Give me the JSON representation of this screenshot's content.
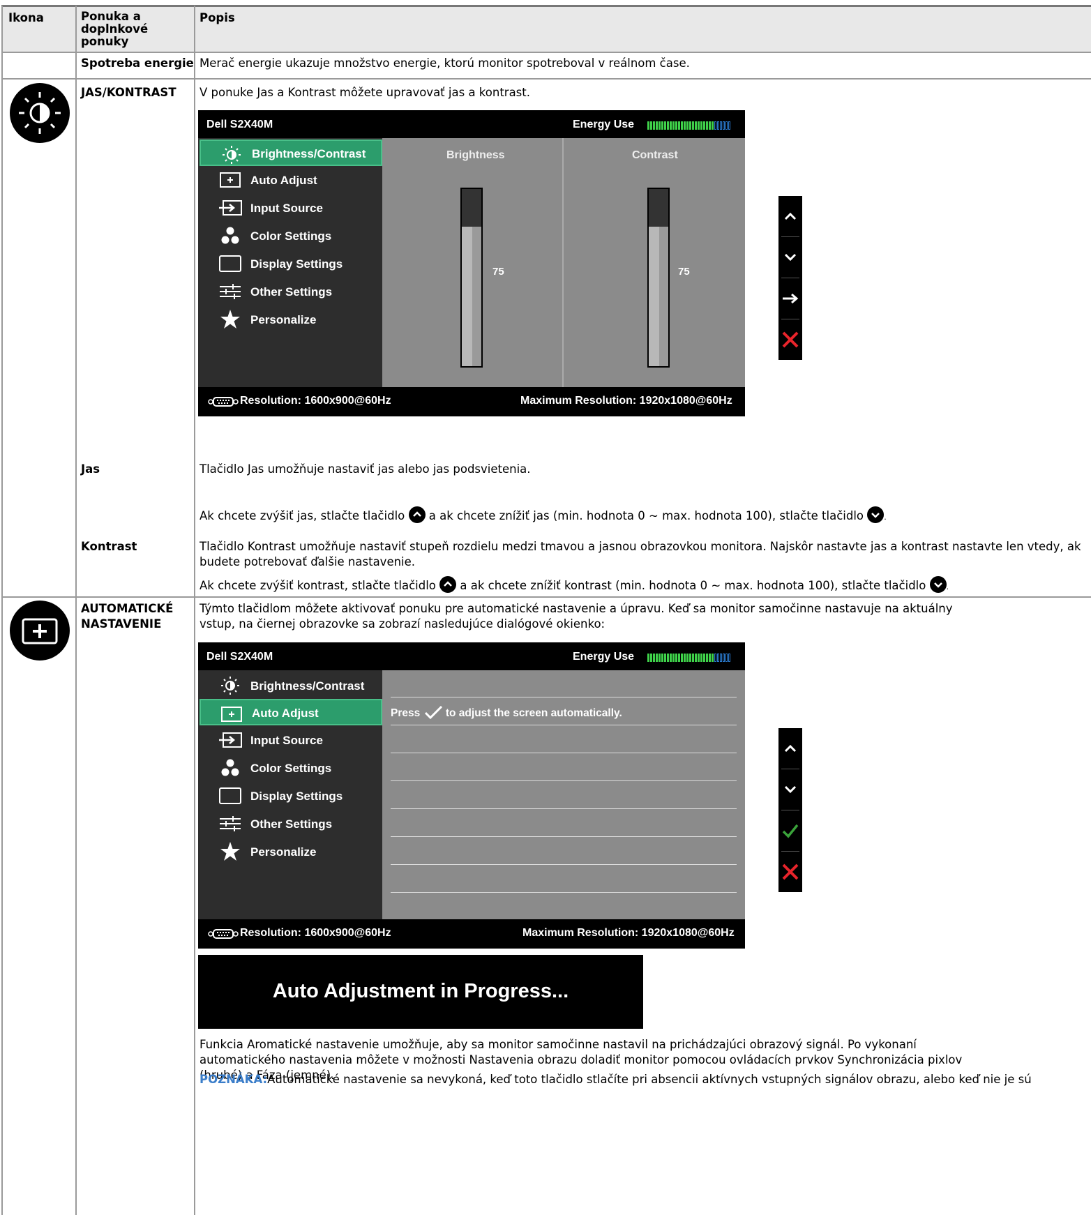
{
  "header": {
    "col_icon": "Ikona",
    "col_menu": "Ponuka a doplnkové ponuky",
    "col_menu_l1": "Ponuka a",
    "col_menu_l2": "doplnkové",
    "col_menu_l3": "ponuky",
    "col_desc": "Popis"
  },
  "rows": {
    "energy": {
      "name": "Spotreba energie",
      "desc": "Merač energie ukazuje množstvo energie, ktorú monitor spotreboval v reálnom čase."
    },
    "brightness": {
      "name": "JAS/KONTRAST",
      "desc": "V ponuke Jas a Kontrast môžete upravovať jas a kontrast."
    },
    "jas": {
      "name": "Jas",
      "desc": "Tlačidlo Jas umožňuje nastaviť jas alebo jas podsvietenia.",
      "desc2a": "Ak chcete zvýšiť jas, stlačte tlačidlo",
      "desc2b": "a ak chcete znížiť jas (min. hodnota 0 ~ max. hodnota 100), stlačte tlačidlo",
      "desc2c": "."
    },
    "kontrast": {
      "name": "Kontrast",
      "desc": "Tlačidlo Kontrast umožňuje nastaviť stupeň rozdielu medzi tmavou a jasnou obrazovkou monitora. Najskôr nastavte jas a kontrast nastavte len vtedy, ak budete potrebovať ďalšie nastavenie.",
      "desc2a": "Ak chcete zvýšiť kontrast, stlačte tlačidlo",
      "desc2b": "a ak chcete znížiť kontrast (min. hodnota 0 ~ max. hodnota 100), stlačte tlačidlo",
      "desc2c": "."
    },
    "auto": {
      "name_l1": "AUTOMATICKÉ",
      "name_l2": "NASTAVENIE",
      "desc": "Týmto tlačidlom môžete aktivovať ponuku pre automatické nastavenie a úpravu. Keď sa monitor samočinne nastavuje na aktuálny vstup, na čiernej obrazovke sa zobrazí nasledujúce dialógové okienko:",
      "progress": "Auto Adjustment in Progress...",
      "desc3": "Funkcia Aromatické nastavenie umožňuje, aby sa monitor samočinne nastavil na prichádzajúci obrazový signál. Po vykonaní automatického nastavenia môžete v možnosti Nastavenia obrazu doladiť monitor pomocou ovládacích prvkov Synchronizácia pixlov (hrubé) a Fáza (jemné).",
      "note_label": "POZNÁKA:",
      "note": "Automatické nastavenie sa nevykoná, keď toto tlačidlo stlačíte pri absencii aktívnych vstupných signálov obrazu, alebo keď nie je sú"
    }
  },
  "osd": {
    "model": "Dell S2X40M",
    "energy_label": "Energy Use",
    "menu": [
      "Brightness/Contrast",
      "Auto Adjust",
      "Input Source",
      "Color Settings",
      "Display Settings",
      "Other Settings",
      "Personalize"
    ],
    "brightness_label": "Brightness",
    "contrast_label": "Contrast",
    "brightness_value": "75",
    "contrast_value": "75",
    "resolution": "Resolution: 1600x900@60Hz",
    "max_resolution": "Maximum Resolution: 1920x1080@60Hz",
    "auto_press": "Press",
    "auto_msg": "to adjust the screen automatically.",
    "energy_level": 0.8
  },
  "colors": {
    "accent_green": "#2c9d6c",
    "note_blue": "#3a7dc9",
    "red_x": "#e8242b"
  }
}
